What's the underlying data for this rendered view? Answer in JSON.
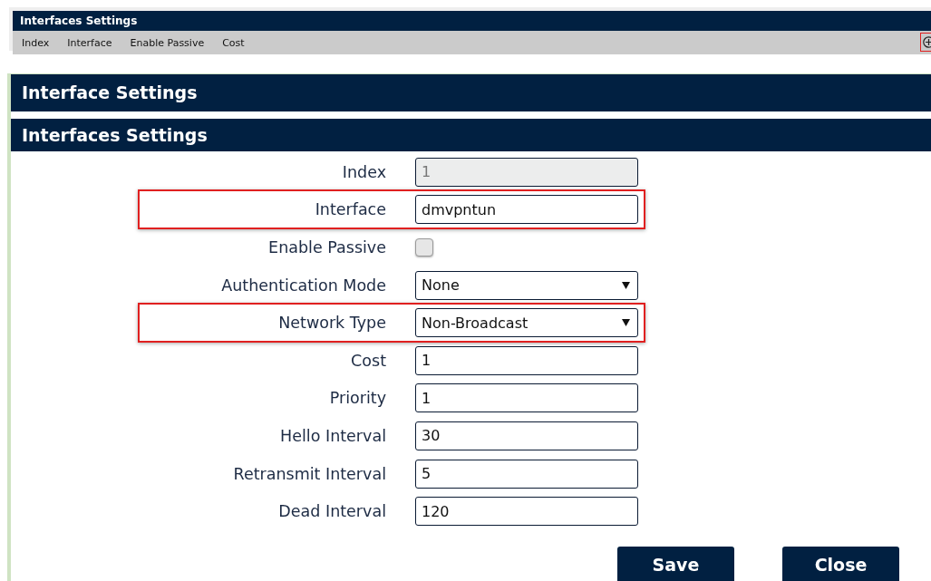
{
  "list_panel": {
    "title": "Interfaces Settings",
    "columns": [
      "Index",
      "Interface",
      "Enable Passive",
      "Cost"
    ],
    "add_highlighted": true
  },
  "dialog": {
    "title": "Interface Settings",
    "section_title": "Interfaces Settings",
    "fields": [
      {
        "kind": "text",
        "label": "Index",
        "value": "1",
        "disabled": true,
        "highlighted": false
      },
      {
        "kind": "text",
        "label": "Interface",
        "value": "dmvpntun",
        "disabled": false,
        "highlighted": true
      },
      {
        "kind": "checkbox",
        "label": "Enable Passive",
        "checked": false,
        "highlighted": false
      },
      {
        "kind": "select",
        "label": "Authentication Mode",
        "value": "None",
        "highlighted": false
      },
      {
        "kind": "select",
        "label": "Network Type",
        "value": "Non-Broadcast",
        "highlighted": true
      },
      {
        "kind": "text",
        "label": "Cost",
        "value": "1",
        "disabled": false,
        "highlighted": false
      },
      {
        "kind": "text",
        "label": "Priority",
        "value": "1",
        "disabled": false,
        "highlighted": false
      },
      {
        "kind": "text",
        "label": "Hello Interval",
        "value": "30",
        "disabled": false,
        "highlighted": false
      },
      {
        "kind": "text",
        "label": "Retransmit Interval",
        "value": "5",
        "disabled": false,
        "highlighted": false
      },
      {
        "kind": "text",
        "label": "Dead Interval",
        "value": "120",
        "disabled": false,
        "highlighted": false
      }
    ],
    "buttons": [
      "Save",
      "Close"
    ]
  }
}
